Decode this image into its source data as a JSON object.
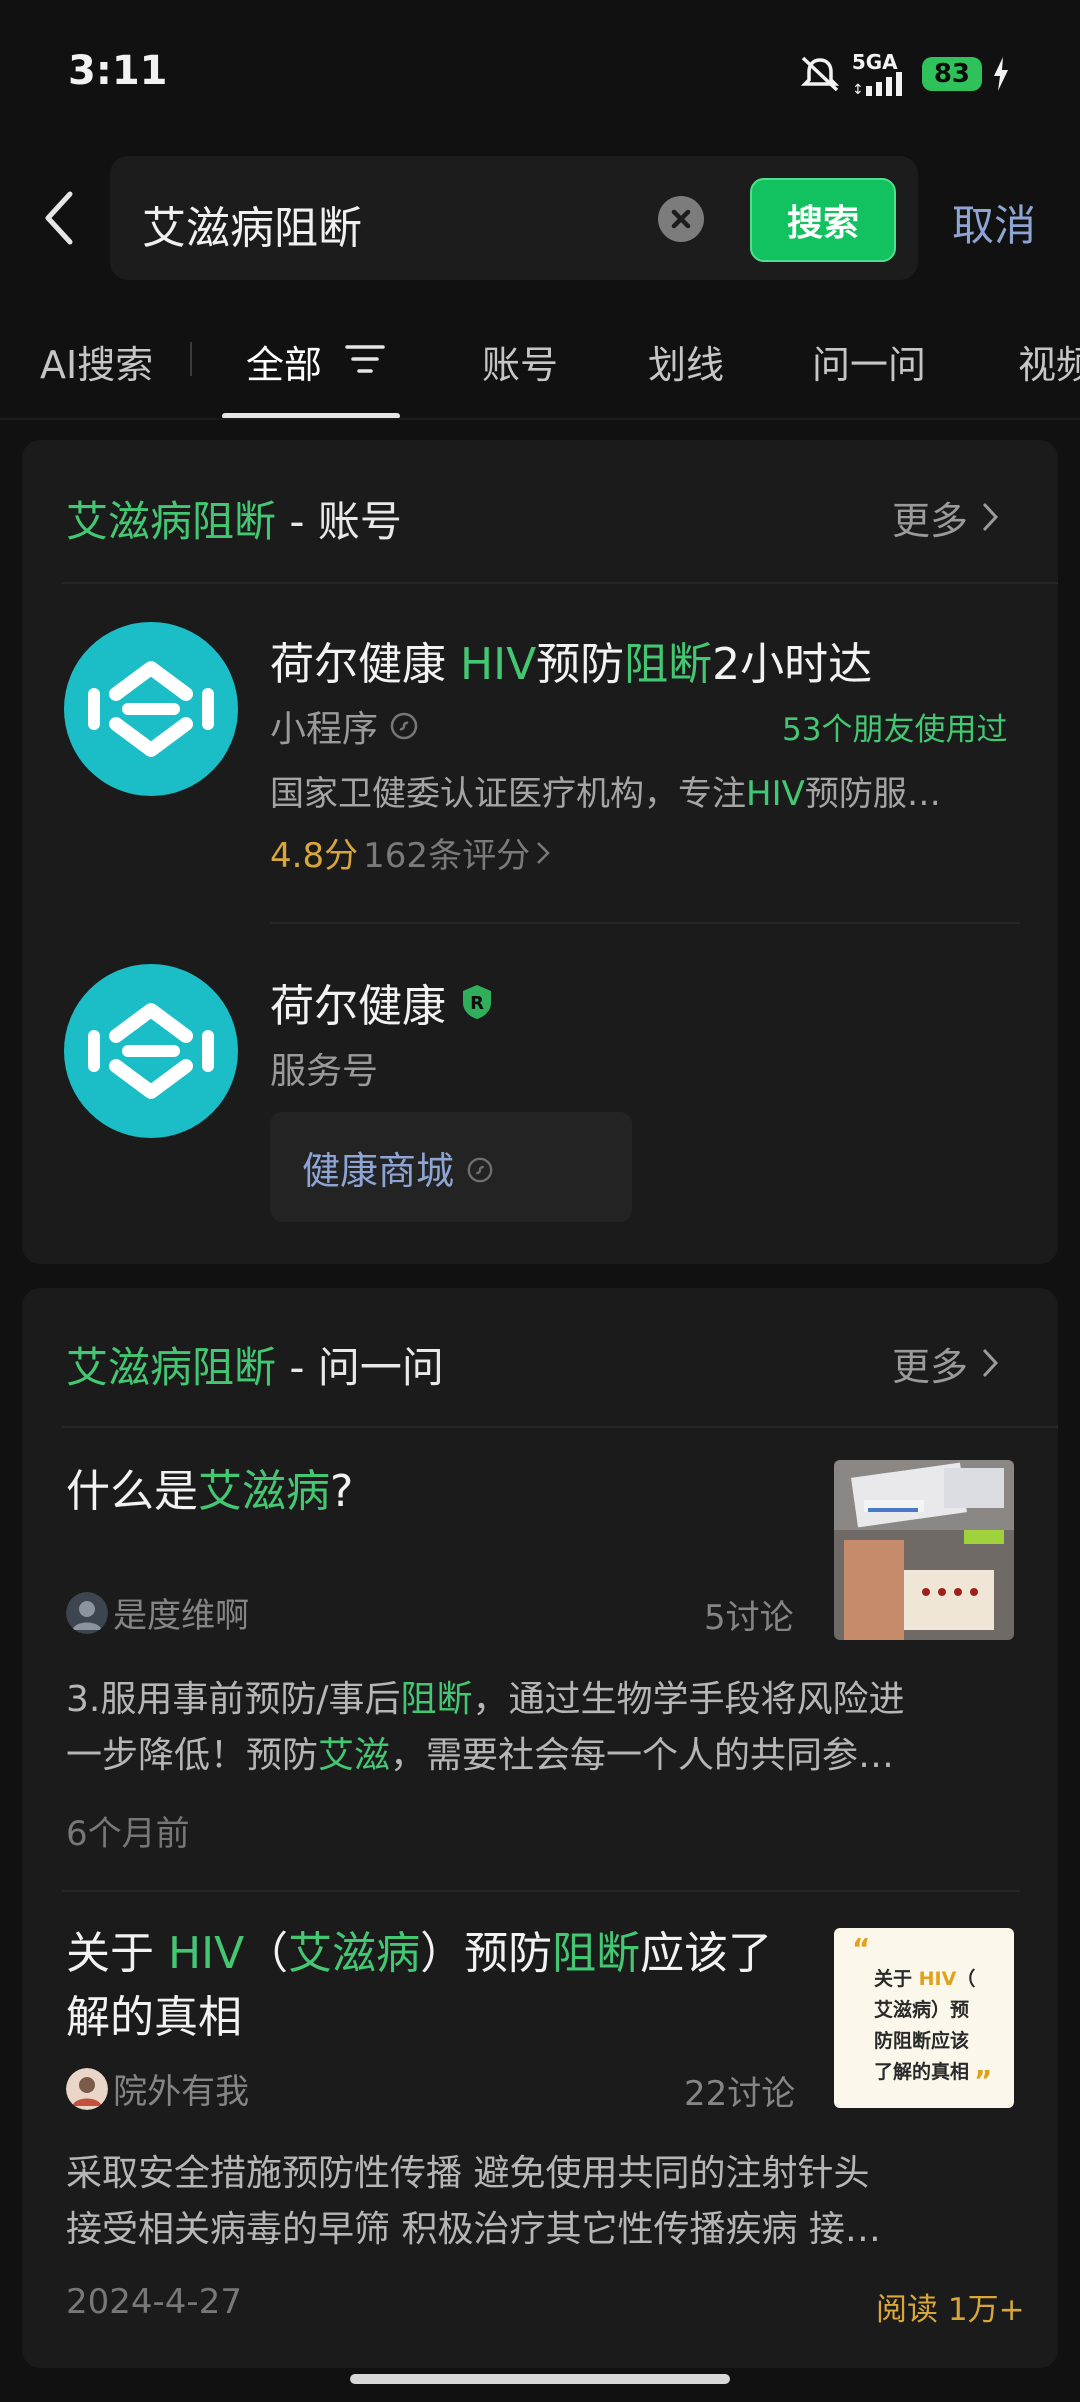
{
  "status_bar": {
    "time": "3:11",
    "network": "5GA",
    "battery": "83"
  },
  "search": {
    "query": "艾滋病阻断",
    "search_button": "搜索",
    "cancel": "取消"
  },
  "tabs": [
    "AI搜索",
    "全部",
    "账号",
    "划线",
    "问一问",
    "视频"
  ],
  "account_section": {
    "title_keyword": "艾滋病阻断",
    "title_suffix": " - 账号",
    "more": "更多",
    "mini_program": {
      "name_part1": "荷尔健康 ",
      "name_hl1": "HIV",
      "name_part2": "预防",
      "name_hl2": "阻断",
      "name_part3": "2小时达",
      "type": "小程序",
      "friends": "53个朋友使用过",
      "desc_part1": "国家卫健委认证医疗机构，专注",
      "desc_hl": "HIV",
      "desc_part2": "预防服…",
      "rating": "4.8分",
      "reviews": "162条评分"
    },
    "service_account": {
      "name": "荷尔健康",
      "badge": "R",
      "type": "服务号",
      "mall_link": "健康商城"
    }
  },
  "qa_section": {
    "title_keyword": "艾滋病阻断",
    "title_suffix": " - 问一问",
    "more": "更多",
    "items": [
      {
        "title_part1": "什么是",
        "title_hl1": "艾滋病",
        "title_part2": "?",
        "author": "是度维啊",
        "count": "5讨论",
        "body_line1_part1": "3.服用事前预防/事后",
        "body_line1_hl": "阻断",
        "body_line1_part2": "，通过生物学手段将风险进",
        "body_line2_part1": "一步降低！预防",
        "body_line2_hl": "艾滋",
        "body_line2_part2": "，需要社会每一个人的共同参…",
        "time": "6个月前"
      },
      {
        "title_part1": "关于 ",
        "title_hl1": "HIV",
        "title_part2": "（",
        "title_hl2": "艾滋病",
        "title_part3": "）预防",
        "title_hl3": "阻断",
        "title_part4": "应该了",
        "title_line2": "解的真相",
        "author": "院外有我",
        "count": "22讨论",
        "body_line1": "采取安全措施预防性传播 避免使用共同的注射针头",
        "body_line2": "接受相关病毒的早筛 积极治疗其它性传播疾病 接…",
        "time": "2024-4-27",
        "reads": "阅读 1万+",
        "thumb_line1_part1": "关于 ",
        "thumb_line1_hl": "HIV",
        "thumb_line1_part2": "（",
        "thumb_line2": "艾滋病）预",
        "thumb_line3": "防阻断应该",
        "thumb_line4": "了解的真相"
      }
    ]
  },
  "colors": {
    "accent_green": "#43c772",
    "button_green": "#12c160",
    "link_blue": "#8ea4d2",
    "rating_gold": "#d8a63b",
    "logo_teal": "#1bbec6"
  }
}
